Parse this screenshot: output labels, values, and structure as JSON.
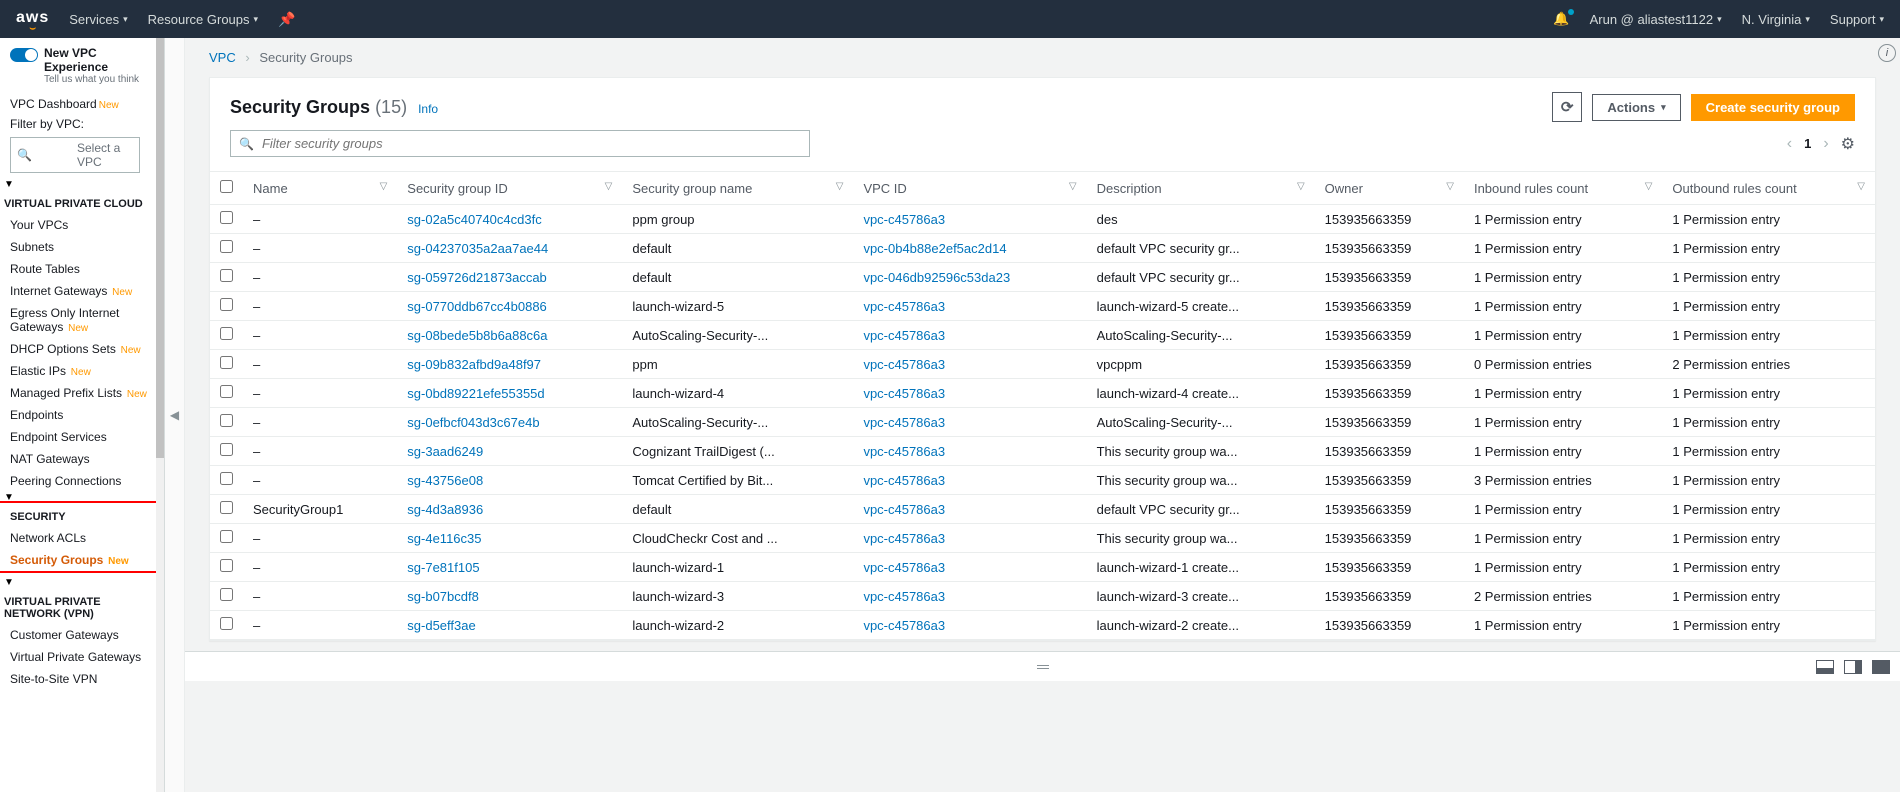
{
  "nav": {
    "logo": "aws",
    "services": "Services",
    "resource_groups": "Resource Groups",
    "user": "Arun @ aliastest1122",
    "region": "N. Virginia",
    "support": "Support"
  },
  "sidebar": {
    "new_experience": "New VPC Experience",
    "new_experience_sub": "Tell us what you think",
    "dashboard": "VPC Dashboard",
    "filter_label": "Filter by VPC:",
    "filter_placeholder": "Select a VPC",
    "vpc_head": "VIRTUAL PRIVATE CLOUD",
    "items_vpc": [
      {
        "label": "Your VPCs",
        "new": false
      },
      {
        "label": "Subnets",
        "new": false
      },
      {
        "label": "Route Tables",
        "new": false
      },
      {
        "label": "Internet Gateways",
        "new": true
      },
      {
        "label": "Egress Only Internet Gateways",
        "new": true
      },
      {
        "label": "DHCP Options Sets",
        "new": true
      },
      {
        "label": "Elastic IPs",
        "new": true
      },
      {
        "label": "Managed Prefix Lists",
        "new": true
      },
      {
        "label": "Endpoints",
        "new": false
      },
      {
        "label": "Endpoint Services",
        "new": false
      },
      {
        "label": "NAT Gateways",
        "new": false
      },
      {
        "label": "Peering Connections",
        "new": false
      }
    ],
    "sec_head": "SECURITY",
    "items_sec": [
      {
        "label": "Network ACLs",
        "new": false,
        "active": false
      },
      {
        "label": "Security Groups",
        "new": true,
        "active": true
      }
    ],
    "vpn_head": "VIRTUAL PRIVATE NETWORK (VPN)",
    "items_vpn": [
      {
        "label": "Customer Gateways",
        "new": false
      },
      {
        "label": "Virtual Private Gateways",
        "new": false
      },
      {
        "label": "Site-to-Site VPN",
        "new": false
      }
    ]
  },
  "breadcrumb": {
    "root": "VPC",
    "current": "Security Groups"
  },
  "panel": {
    "title": "Security Groups",
    "count": "(15)",
    "info": "Info",
    "actions_btn": "Actions",
    "create_btn": "Create security group",
    "search_placeholder": "Filter security groups",
    "page_num": "1"
  },
  "columns": [
    "Name",
    "Security group ID",
    "Security group name",
    "VPC ID",
    "Description",
    "Owner",
    "Inbound rules count",
    "Outbound rules count"
  ],
  "rows": [
    {
      "name": "–",
      "sgid": "sg-02a5c40740c4cd3fc",
      "sgname": "ppm group",
      "vpc": "vpc-c45786a3",
      "desc": "des",
      "owner": "153935663359",
      "in": "1 Permission entry",
      "out": "1 Permission entry"
    },
    {
      "name": "–",
      "sgid": "sg-04237035a2aa7ae44",
      "sgname": "default",
      "vpc": "vpc-0b4b88e2ef5ac2d14",
      "desc": "default VPC security gr...",
      "owner": "153935663359",
      "in": "1 Permission entry",
      "out": "1 Permission entry"
    },
    {
      "name": "–",
      "sgid": "sg-059726d21873accab",
      "sgname": "default",
      "vpc": "vpc-046db92596c53da23",
      "desc": "default VPC security gr...",
      "owner": "153935663359",
      "in": "1 Permission entry",
      "out": "1 Permission entry"
    },
    {
      "name": "–",
      "sgid": "sg-0770ddb67cc4b0886",
      "sgname": "launch-wizard-5",
      "vpc": "vpc-c45786a3",
      "desc": "launch-wizard-5 create...",
      "owner": "153935663359",
      "in": "1 Permission entry",
      "out": "1 Permission entry"
    },
    {
      "name": "–",
      "sgid": "sg-08bede5b8b6a88c6a",
      "sgname": "AutoScaling-Security-...",
      "vpc": "vpc-c45786a3",
      "desc": "AutoScaling-Security-...",
      "owner": "153935663359",
      "in": "1 Permission entry",
      "out": "1 Permission entry"
    },
    {
      "name": "–",
      "sgid": "sg-09b832afbd9a48f97",
      "sgname": "ppm",
      "vpc": "vpc-c45786a3",
      "desc": "vpcppm",
      "owner": "153935663359",
      "in": "0 Permission entries",
      "out": "2 Permission entries"
    },
    {
      "name": "–",
      "sgid": "sg-0bd89221efe55355d",
      "sgname": "launch-wizard-4",
      "vpc": "vpc-c45786a3",
      "desc": "launch-wizard-4 create...",
      "owner": "153935663359",
      "in": "1 Permission entry",
      "out": "1 Permission entry"
    },
    {
      "name": "–",
      "sgid": "sg-0efbcf043d3c67e4b",
      "sgname": "AutoScaling-Security-...",
      "vpc": "vpc-c45786a3",
      "desc": "AutoScaling-Security-...",
      "owner": "153935663359",
      "in": "1 Permission entry",
      "out": "1 Permission entry"
    },
    {
      "name": "–",
      "sgid": "sg-3aad6249",
      "sgname": "Cognizant TrailDigest (...",
      "vpc": "vpc-c45786a3",
      "desc": "This security group wa...",
      "owner": "153935663359",
      "in": "1 Permission entry",
      "out": "1 Permission entry"
    },
    {
      "name": "–",
      "sgid": "sg-43756e08",
      "sgname": "Tomcat Certified by Bit...",
      "vpc": "vpc-c45786a3",
      "desc": "This security group wa...",
      "owner": "153935663359",
      "in": "3 Permission entries",
      "out": "1 Permission entry"
    },
    {
      "name": "SecurityGroup1",
      "sgid": "sg-4d3a8936",
      "sgname": "default",
      "vpc": "vpc-c45786a3",
      "desc": "default VPC security gr...",
      "owner": "153935663359",
      "in": "1 Permission entry",
      "out": "1 Permission entry"
    },
    {
      "name": "–",
      "sgid": "sg-4e116c35",
      "sgname": "CloudCheckr Cost and ...",
      "vpc": "vpc-c45786a3",
      "desc": "This security group wa...",
      "owner": "153935663359",
      "in": "1 Permission entry",
      "out": "1 Permission entry"
    },
    {
      "name": "–",
      "sgid": "sg-7e81f105",
      "sgname": "launch-wizard-1",
      "vpc": "vpc-c45786a3",
      "desc": "launch-wizard-1 create...",
      "owner": "153935663359",
      "in": "1 Permission entry",
      "out": "1 Permission entry"
    },
    {
      "name": "–",
      "sgid": "sg-b07bcdf8",
      "sgname": "launch-wizard-3",
      "vpc": "vpc-c45786a3",
      "desc": "launch-wizard-3 create...",
      "owner": "153935663359",
      "in": "2 Permission entries",
      "out": "1 Permission entry"
    },
    {
      "name": "–",
      "sgid": "sg-d5eff3ae",
      "sgname": "launch-wizard-2",
      "vpc": "vpc-c45786a3",
      "desc": "launch-wizard-2 create...",
      "owner": "153935663359",
      "in": "1 Permission entry",
      "out": "1 Permission entry"
    }
  ]
}
